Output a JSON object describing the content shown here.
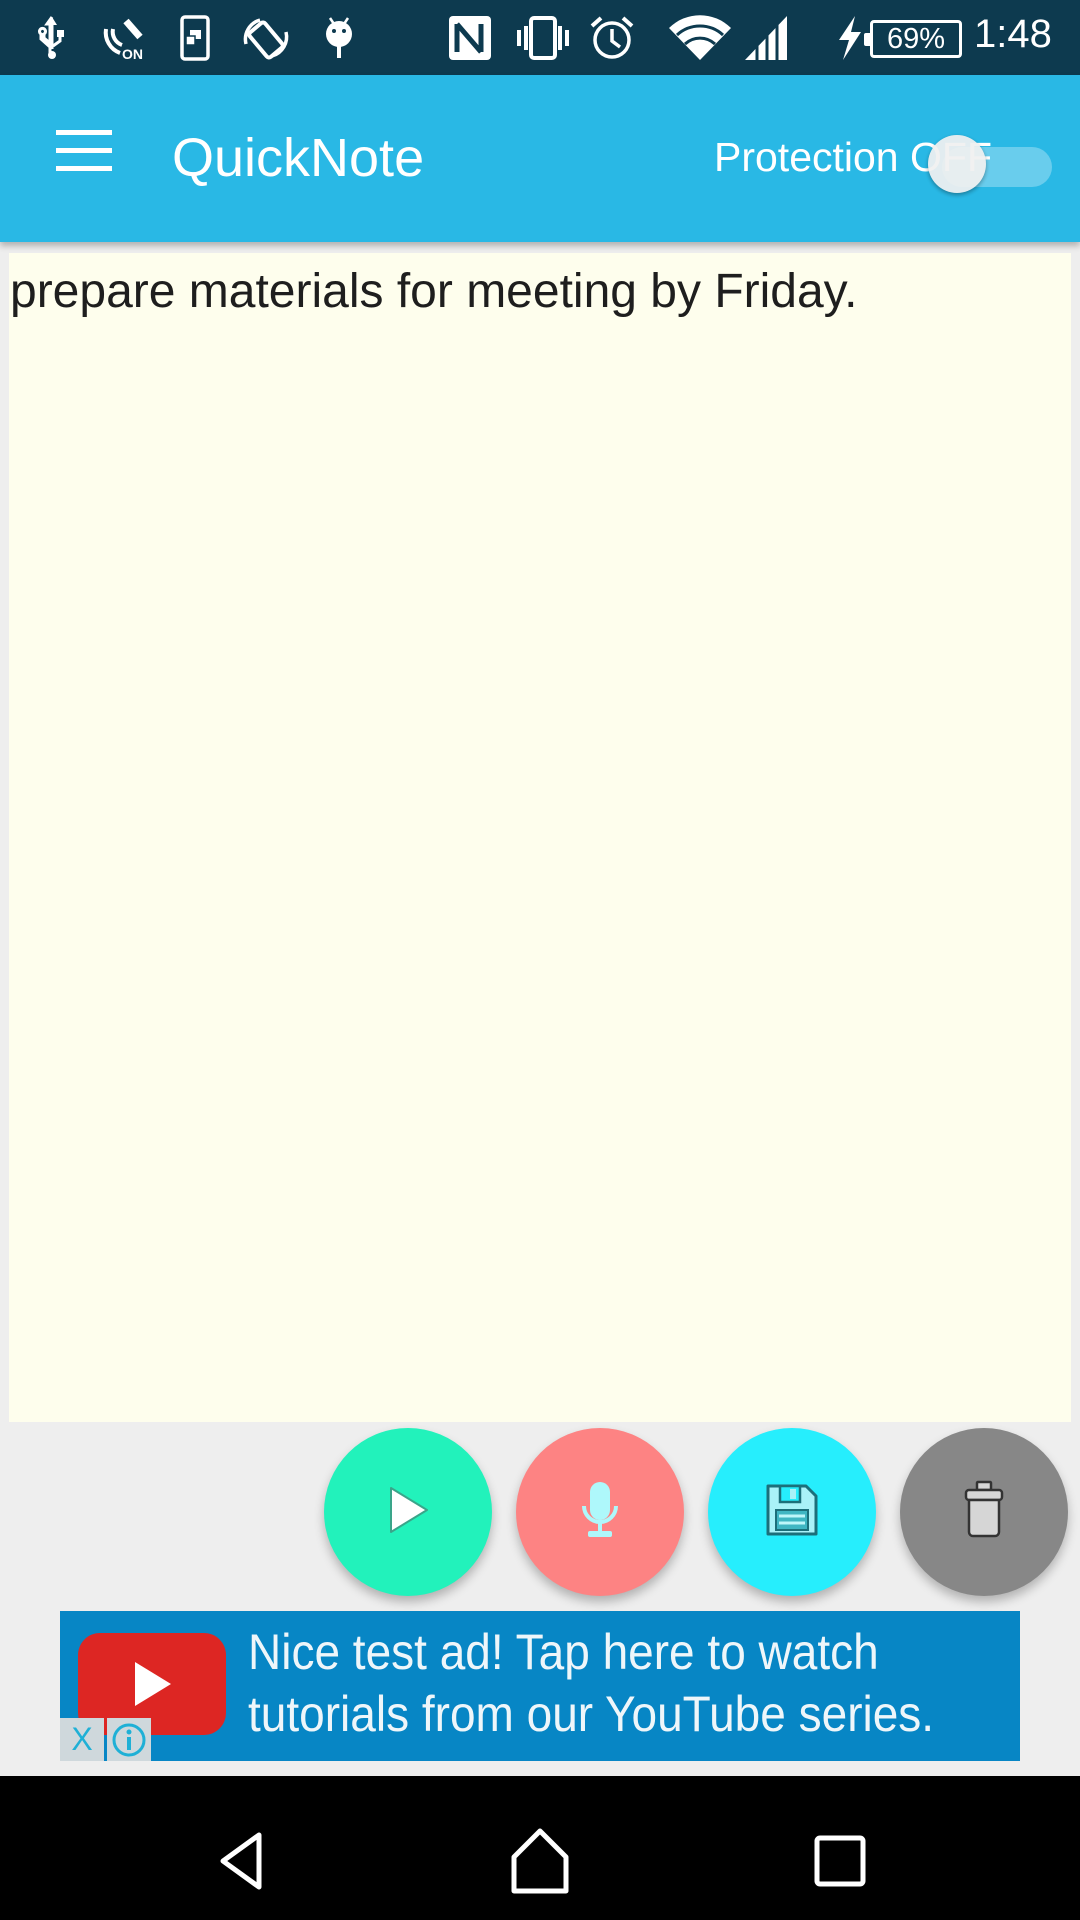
{
  "status_bar": {
    "icons": [
      "usb-icon",
      "volte-on-icon",
      "screen-mirror-icon",
      "auto-rotate-icon",
      "android-debug-icon",
      "nfc-icon",
      "vibrate-icon",
      "alarm-icon",
      "wifi-icon",
      "cell-signal-icon",
      "charging-icon"
    ],
    "battery_level": "69%",
    "time": "1:48"
  },
  "app_bar": {
    "title": "QuickNote",
    "menu_icon": "hamburger-menu-icon",
    "protection_label": "Protection",
    "protection_state": "OFF",
    "protection_enabled": false
  },
  "note": {
    "text": "prepare materials for meeting by Friday."
  },
  "actions": [
    {
      "name": "play",
      "icon": "play-icon",
      "color": "#22f2bb"
    },
    {
      "name": "record",
      "icon": "microphone-icon",
      "color": "#fd8383"
    },
    {
      "name": "save",
      "icon": "floppy-disk-icon",
      "color": "#26eefd"
    },
    {
      "name": "delete",
      "icon": "trash-icon",
      "color": "#878787"
    }
  ],
  "ad": {
    "line1": "Nice test ad!  Tap here to watch",
    "line2": "tutorials from our YouTube series.",
    "close_label": "X",
    "info_label": "i"
  },
  "nav_bar": {
    "buttons": [
      "back",
      "home",
      "recents"
    ]
  },
  "colors": {
    "status_bar": "#0d3a4f",
    "app_bar": "#29b8e5",
    "note_background": "#fefeed",
    "ad_background": "#0786c5"
  }
}
